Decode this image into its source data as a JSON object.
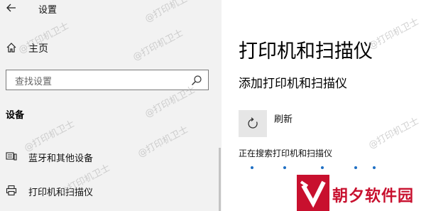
{
  "window": {
    "title": "设置"
  },
  "sidebar": {
    "home_label": "主页",
    "search_placeholder": "查找设置",
    "section_title": "设备",
    "items": [
      {
        "label": "蓝牙和其他设备",
        "icon": "bluetooth-devices-icon"
      },
      {
        "label": "打印机和扫描仪",
        "icon": "printer-icon"
      }
    ]
  },
  "main": {
    "page_title": "打印机和扫描仪",
    "sub_title": "添加打印机和扫描仪",
    "refresh_label": "刷新",
    "searching_text": "正在搜索打印机和扫描仪"
  },
  "watermark": {
    "text": "@打印机卫士"
  },
  "brand": {
    "text": "朝夕软件园"
  },
  "colors": {
    "accent": "#1f6fc4",
    "brand_red": "#c8102e",
    "sidebar_bg": "#f2f2f2"
  }
}
